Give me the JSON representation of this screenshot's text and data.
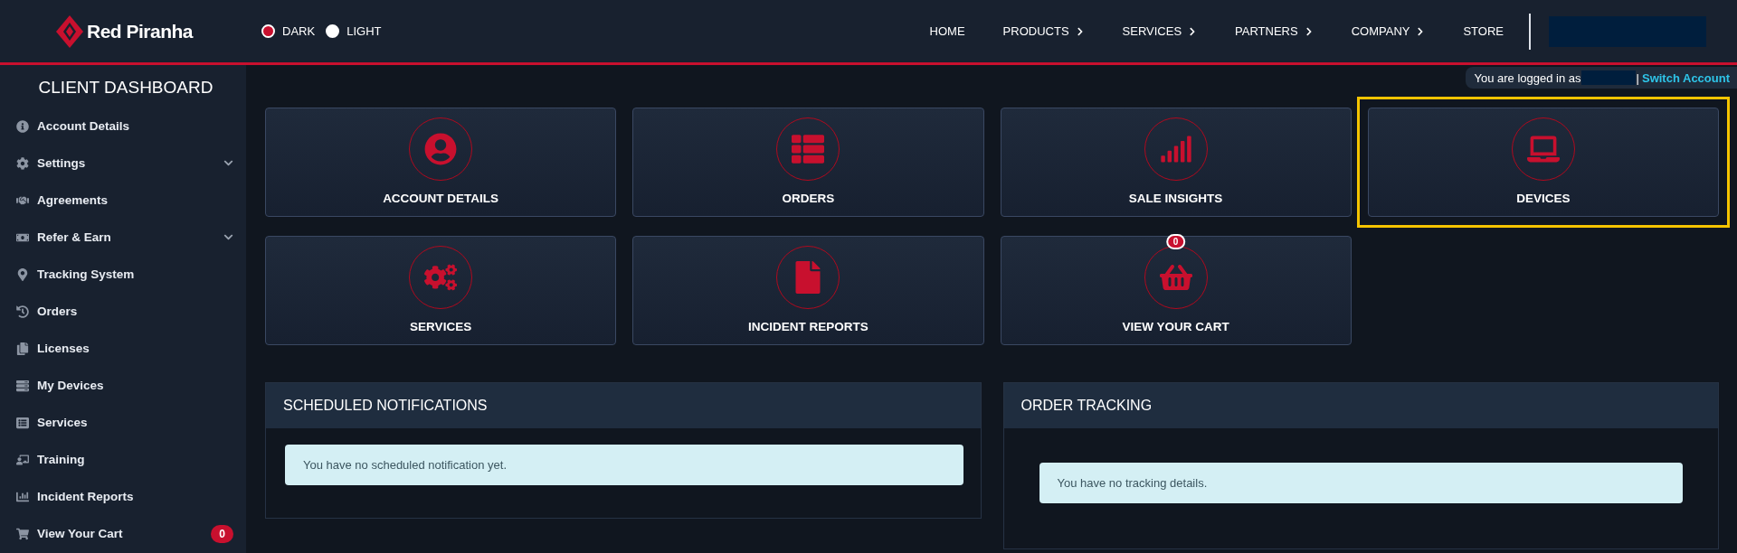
{
  "header": {
    "logo": "Red Piranha",
    "theme_options": [
      {
        "label": "DARK",
        "selected": true
      },
      {
        "label": "LIGHT",
        "selected": false
      }
    ],
    "nav": [
      {
        "label": "HOME",
        "kind": "link"
      },
      {
        "label": "PRODUCTS",
        "kind": "submenu"
      },
      {
        "label": "SERVICES",
        "kind": "submenu"
      },
      {
        "label": "PARTNERS",
        "kind": "submenu"
      },
      {
        "label": "COMPANY",
        "kind": "submenu"
      },
      {
        "label": "STORE",
        "kind": "link"
      }
    ]
  },
  "sidebar": {
    "title": "CLIENT DASHBOARD",
    "items": [
      {
        "label": "Account Details",
        "kind": "link"
      },
      {
        "label": "Settings",
        "kind": "submenu"
      },
      {
        "label": "Agreements",
        "kind": "link"
      },
      {
        "label": "Refer & Earn",
        "kind": "submenu"
      },
      {
        "label": "Tracking System",
        "kind": "link"
      },
      {
        "label": "Orders",
        "kind": "link"
      },
      {
        "label": "Licenses",
        "kind": "link"
      },
      {
        "label": "My Devices",
        "kind": "link"
      },
      {
        "label": "Services",
        "kind": "link"
      },
      {
        "label": "Training",
        "kind": "link"
      },
      {
        "label": "Incident Reports",
        "kind": "link"
      },
      {
        "label": "View Your Cart",
        "kind": "badge",
        "badge": "0"
      }
    ]
  },
  "login_bar": {
    "text": "You are logged in as",
    "separator": "|",
    "link": "Switch Account"
  },
  "tiles": [
    {
      "label": "ACCOUNT DETAILS",
      "highlighted": false
    },
    {
      "label": "ORDERS",
      "highlighted": false
    },
    {
      "label": "SALE INSIGHTS",
      "highlighted": false
    },
    {
      "label": "DEVICES",
      "highlighted": true
    },
    {
      "label": "SERVICES",
      "highlighted": false
    },
    {
      "label": "INCIDENT REPORTS",
      "highlighted": false
    },
    {
      "label": "VIEW YOUR CART",
      "highlighted": false,
      "badge": "0"
    }
  ],
  "panels": [
    {
      "title": "SCHEDULED NOTIFICATIONS",
      "message": "You have no scheduled notification yet.",
      "kind": "compact"
    },
    {
      "title": "ORDER TRACKING",
      "message": "You have no tracking details.",
      "kind": "spacious"
    }
  ]
}
